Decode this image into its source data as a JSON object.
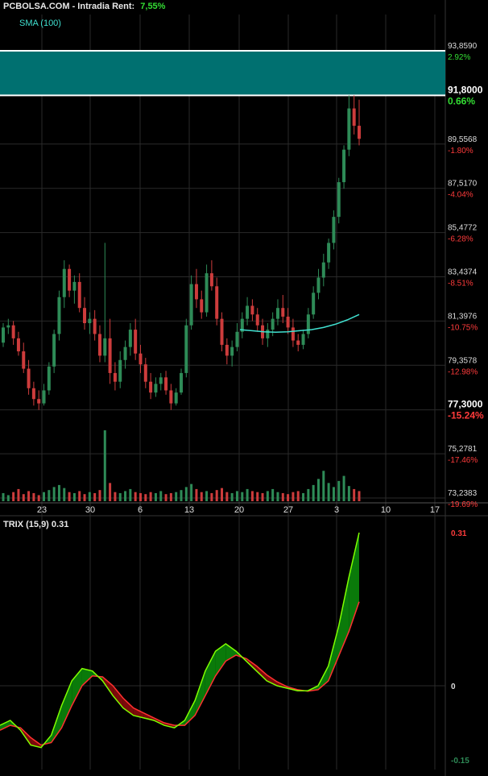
{
  "header": {
    "site": "PCBOLSA.COM",
    "mode": "Intradia",
    "rent_label": "Rent:",
    "rent_value": "7,55%"
  },
  "indicator_label": "SMA (100)",
  "trix_label": "TRIX (15,9) 0.31",
  "colors": {
    "background": "#000000",
    "grid": "#2a2a2a",
    "up": "#2e8b57",
    "down": "#cd3c3c",
    "band": "#007070",
    "sma": "#40e0d0",
    "trix": "#7fff00",
    "signal": "#ff3030",
    "trix_fill_up": "#0a7a0a",
    "trix_fill_down": "#7a0a0a",
    "label_neg": "#ff3b3b",
    "label_pos": "#33dd33"
  },
  "chart_data": [
    {
      "type": "candlestick",
      "y_axis_levels": [
        {
          "value": 93.859,
          "label": "93,8590",
          "pct": "2.92%",
          "highlight": false
        },
        {
          "value": 91.8,
          "label": "91,8000",
          "pct": "0.66%",
          "highlight": true
        },
        {
          "value": 89.5568,
          "label": "89,5568",
          "pct": "-1.80%",
          "highlight": false
        },
        {
          "value": 87.517,
          "label": "87,5170",
          "pct": "-4.04%",
          "highlight": false
        },
        {
          "value": 85.4772,
          "label": "85,4772",
          "pct": "-6.28%",
          "highlight": false
        },
        {
          "value": 83.4374,
          "label": "83,4374",
          "pct": "-8.51%",
          "highlight": false
        },
        {
          "value": 81.3976,
          "label": "81,3976",
          "pct": "-10.75%",
          "highlight": false
        },
        {
          "value": 79.3578,
          "label": "79,3578",
          "pct": "-12.98%",
          "highlight": false
        },
        {
          "value": 77.3,
          "label": "77,3000",
          "pct": "-15.24%",
          "highlight": true
        },
        {
          "value": 75.2781,
          "label": "75,2781",
          "pct": "-17.46%",
          "highlight": false
        },
        {
          "value": 73.2383,
          "label": "73,2383",
          "pct": "-19.69%",
          "highlight": false
        }
      ],
      "ylim": [
        73.2383,
        93.859
      ],
      "x_ticks": [
        "23",
        "30",
        "6",
        "13",
        "20",
        "27",
        "3",
        "10",
        "17"
      ],
      "band": [
        91.8,
        93.859
      ],
      "series": {
        "candles": [
          [
            80.4,
            81.3,
            80.2,
            81.1
          ],
          [
            81.1,
            81.5,
            80.8,
            81.2
          ],
          [
            81.2,
            81.4,
            80.3,
            80.6
          ],
          [
            80.6,
            80.9,
            79.8,
            80.0
          ],
          [
            80.0,
            80.4,
            79.0,
            79.2
          ],
          [
            79.2,
            79.6,
            78.0,
            78.3
          ],
          [
            78.3,
            78.6,
            77.5,
            77.8
          ],
          [
            77.8,
            78.2,
            77.3,
            77.6
          ],
          [
            77.6,
            78.5,
            77.5,
            78.2
          ],
          [
            78.2,
            79.5,
            78.0,
            79.3
          ],
          [
            79.3,
            81.0,
            79.0,
            80.8
          ],
          [
            80.8,
            82.8,
            80.5,
            82.5
          ],
          [
            82.5,
            84.2,
            82.0,
            83.8
          ],
          [
            83.8,
            84.0,
            82.5,
            82.8
          ],
          [
            82.8,
            83.5,
            82.2,
            83.2
          ],
          [
            83.2,
            83.6,
            81.8,
            82.0
          ],
          [
            82.0,
            82.5,
            81.0,
            81.3
          ],
          [
            81.3,
            81.8,
            80.8,
            81.5
          ],
          [
            81.5,
            81.9,
            80.5,
            80.8
          ],
          [
            80.8,
            81.2,
            79.5,
            79.8
          ],
          [
            79.8,
            85.0,
            79.5,
            80.6
          ],
          [
            80.6,
            81.5,
            78.5,
            79.0
          ],
          [
            79.0,
            79.5,
            78.2,
            78.6
          ],
          [
            78.6,
            80.0,
            78.3,
            79.6
          ],
          [
            79.6,
            80.5,
            79.2,
            80.2
          ],
          [
            80.2,
            81.3,
            79.8,
            81.0
          ],
          [
            81.0,
            81.5,
            79.6,
            79.9
          ],
          [
            79.9,
            80.3,
            79.0,
            79.4
          ],
          [
            79.4,
            79.7,
            78.3,
            78.6
          ],
          [
            78.6,
            79.0,
            77.8,
            78.1
          ],
          [
            78.1,
            78.8,
            77.9,
            78.5
          ],
          [
            78.5,
            79.0,
            78.2,
            78.8
          ],
          [
            78.8,
            79.1,
            78.0,
            78.2
          ],
          [
            78.2,
            78.5,
            77.3,
            77.6
          ],
          [
            77.6,
            78.3,
            77.5,
            78.1
          ],
          [
            78.1,
            79.2,
            78.0,
            79.0
          ],
          [
            79.0,
            81.5,
            78.8,
            81.2
          ],
          [
            81.2,
            83.5,
            81.0,
            83.1
          ],
          [
            83.1,
            83.8,
            82.0,
            82.4
          ],
          [
            82.4,
            82.8,
            81.5,
            81.8
          ],
          [
            81.8,
            84.0,
            81.6,
            83.6
          ],
          [
            83.6,
            84.2,
            82.8,
            83.0
          ],
          [
            83.0,
            83.4,
            81.2,
            81.5
          ],
          [
            81.5,
            81.8,
            80.0,
            80.3
          ],
          [
            80.3,
            80.6,
            79.4,
            79.8
          ],
          [
            79.8,
            80.5,
            79.3,
            80.2
          ],
          [
            80.2,
            81.3,
            80.0,
            80.9
          ],
          [
            80.9,
            81.8,
            80.6,
            81.5
          ],
          [
            81.5,
            82.5,
            81.2,
            82.1
          ],
          [
            82.1,
            82.4,
            81.4,
            81.7
          ],
          [
            81.7,
            82.0,
            80.9,
            81.2
          ],
          [
            81.2,
            81.5,
            80.3,
            80.6
          ],
          [
            80.6,
            81.3,
            80.2,
            81.0
          ],
          [
            81.0,
            81.8,
            80.7,
            81.5
          ],
          [
            81.5,
            82.4,
            81.2,
            82.0
          ],
          [
            82.0,
            82.6,
            81.3,
            81.6
          ],
          [
            81.6,
            82.0,
            80.8,
            81.1
          ],
          [
            81.1,
            81.5,
            80.2,
            80.5
          ],
          [
            80.5,
            80.8,
            80.0,
            80.3
          ],
          [
            80.3,
            81.0,
            80.1,
            80.8
          ],
          [
            80.8,
            82.0,
            80.6,
            81.7
          ],
          [
            81.7,
            83.0,
            81.5,
            82.7
          ],
          [
            82.7,
            83.8,
            82.4,
            83.4
          ],
          [
            83.4,
            84.5,
            83.0,
            84.1
          ],
          [
            84.1,
            85.2,
            83.8,
            85.0
          ],
          [
            85.0,
            86.5,
            84.7,
            86.2
          ],
          [
            86.2,
            88.0,
            85.9,
            87.8
          ],
          [
            87.8,
            89.5,
            87.5,
            89.3
          ],
          [
            89.3,
            91.8,
            89.0,
            91.2
          ],
          [
            91.2,
            91.8,
            90.0,
            90.4
          ],
          [
            90.4,
            91.6,
            89.5,
            89.8
          ]
        ],
        "volumes": [
          8,
          6,
          9,
          12,
          7,
          10,
          8,
          6,
          9,
          11,
          14,
          16,
          13,
          9,
          8,
          10,
          7,
          9,
          8,
          11,
          70,
          18,
          9,
          8,
          10,
          12,
          9,
          8,
          7,
          9,
          8,
          10,
          7,
          8,
          9,
          11,
          14,
          17,
          12,
          9,
          10,
          8,
          11,
          13,
          9,
          8,
          10,
          9,
          12,
          10,
          9,
          8,
          10,
          12,
          9,
          8,
          7,
          9,
          10,
          8,
          12,
          16,
          22,
          30,
          18,
          14,
          20,
          25,
          15,
          12,
          10
        ],
        "sma": [
          81.0,
          80.95,
          80.9,
          80.88,
          80.9,
          80.95,
          81.0,
          81.1,
          81.25,
          81.45,
          81.7
        ]
      }
    },
    {
      "type": "line",
      "title": "TRIX (15,9)",
      "ylim": [
        -0.15,
        0.31
      ],
      "y_ticks": [
        {
          "value": 0.31,
          "label": "0.31"
        },
        {
          "value": 0,
          "label": "0"
        },
        {
          "value": -0.15,
          "label": "-0.15"
        }
      ],
      "trix": [
        -0.08,
        -0.07,
        -0.09,
        -0.12,
        -0.125,
        -0.1,
        -0.04,
        0.01,
        0.035,
        0.03,
        0.01,
        -0.02,
        -0.045,
        -0.06,
        -0.065,
        -0.07,
        -0.08,
        -0.085,
        -0.07,
        -0.03,
        0.03,
        0.07,
        0.085,
        0.07,
        0.05,
        0.03,
        0.01,
        0.0,
        -0.005,
        -0.01,
        -0.01,
        0.0,
        0.04,
        0.12,
        0.22,
        0.31
      ],
      "signal": [
        -0.09,
        -0.08,
        -0.085,
        -0.105,
        -0.12,
        -0.115,
        -0.085,
        -0.04,
        0.0,
        0.02,
        0.018,
        0.0,
        -0.025,
        -0.045,
        -0.055,
        -0.065,
        -0.075,
        -0.08,
        -0.08,
        -0.06,
        -0.02,
        0.02,
        0.05,
        0.062,
        0.055,
        0.04,
        0.022,
        0.008,
        -0.002,
        -0.008,
        -0.011,
        -0.008,
        0.01,
        0.06,
        0.11,
        0.17
      ]
    }
  ]
}
